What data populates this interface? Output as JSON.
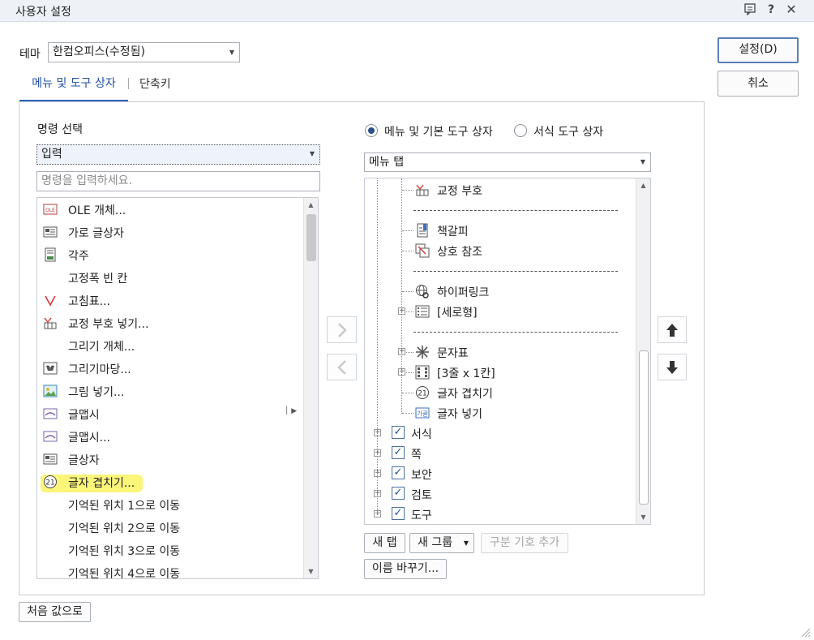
{
  "window": {
    "title": "사용자 설정"
  },
  "theme": {
    "label": "테마",
    "value": "한컴오피스(수정됨)"
  },
  "tabs": [
    {
      "label": "메뉴 및 도구 상자"
    },
    {
      "label": "단축키"
    }
  ],
  "buttons": {
    "ok": "설정(D)",
    "cancel": "취소",
    "reset": "처음 값으로"
  },
  "command_select": {
    "label": "명령 선택",
    "category": "입력",
    "search_placeholder": "명령을 입력하세요.",
    "items": [
      {
        "label": "OLE 개체...",
        "icon": "ole-icon"
      },
      {
        "label": "가로 글상자",
        "icon": "textbox-icon"
      },
      {
        "label": "각주",
        "icon": "footnote-icon"
      },
      {
        "label": "고정폭 빈 칸",
        "icon": ""
      },
      {
        "label": "고침표...",
        "icon": "correction-mark-icon"
      },
      {
        "label": "교정 부호 넣기...",
        "icon": "proof-mark-icon"
      },
      {
        "label": "그리기 개체...",
        "icon": ""
      },
      {
        "label": "그리기마당...",
        "icon": "clipart-icon"
      },
      {
        "label": "그림 넣기...",
        "icon": "picture-icon"
      },
      {
        "label": "글맵시",
        "icon": "textart-icon",
        "submenu": true
      },
      {
        "label": "글맵시...",
        "icon": "textart-icon"
      },
      {
        "label": "글상자",
        "icon": "textbox-icon"
      },
      {
        "label": "글자 겹치기...",
        "icon": "overlap-char-icon",
        "highlighted": true
      },
      {
        "label": "기억된 위치 1으로 이동",
        "icon": ""
      },
      {
        "label": "기억된 위치 2으로 이동",
        "icon": ""
      },
      {
        "label": "기억된 위치 3으로 이동",
        "icon": ""
      },
      {
        "label": "기억된 위치 4으로 이동",
        "icon": ""
      }
    ]
  },
  "target": {
    "radio_menu": "메뉴 및 기본 도구 상자",
    "radio_format": "서식 도구 상자",
    "selected": "radio_menu",
    "combo": "메뉴 탭",
    "tree": [
      {
        "label": "교정 부호",
        "type": "item",
        "icon": "proof-mark-icon"
      },
      {
        "type": "separator",
        "label": "-----------------------------"
      },
      {
        "label": "책갈피",
        "type": "item",
        "icon": "bookmark-icon"
      },
      {
        "label": "상호 참조",
        "type": "item",
        "icon": "cross-ref-icon"
      },
      {
        "type": "separator",
        "label": "-----------------------------"
      },
      {
        "label": "하이퍼링크",
        "type": "item",
        "icon": "hyperlink-icon"
      },
      {
        "label": "[세로형]",
        "type": "group",
        "icon": "list-icon"
      },
      {
        "type": "separator",
        "label": "-----------------------------"
      },
      {
        "label": "문자표",
        "type": "group",
        "icon": "symbol-icon"
      },
      {
        "label": "[3줄 x 1칸]",
        "type": "group",
        "icon": "grid-icon"
      },
      {
        "label": "글자 겹치기",
        "type": "item",
        "icon": "overlap-char-icon"
      },
      {
        "label": "글자 넣기",
        "type": "item",
        "icon": "insert-char-icon"
      },
      {
        "label": "서식",
        "type": "top"
      },
      {
        "label": "쪽",
        "type": "top"
      },
      {
        "label": "보안",
        "type": "top"
      },
      {
        "label": "검토",
        "type": "top"
      },
      {
        "label": "도구",
        "type": "top"
      }
    ],
    "buttons": {
      "new_tab": "새 탭",
      "new_group": "새 그룹",
      "add_separator": "구분 기호 추가",
      "rename": "이름 바꾸기..."
    }
  }
}
